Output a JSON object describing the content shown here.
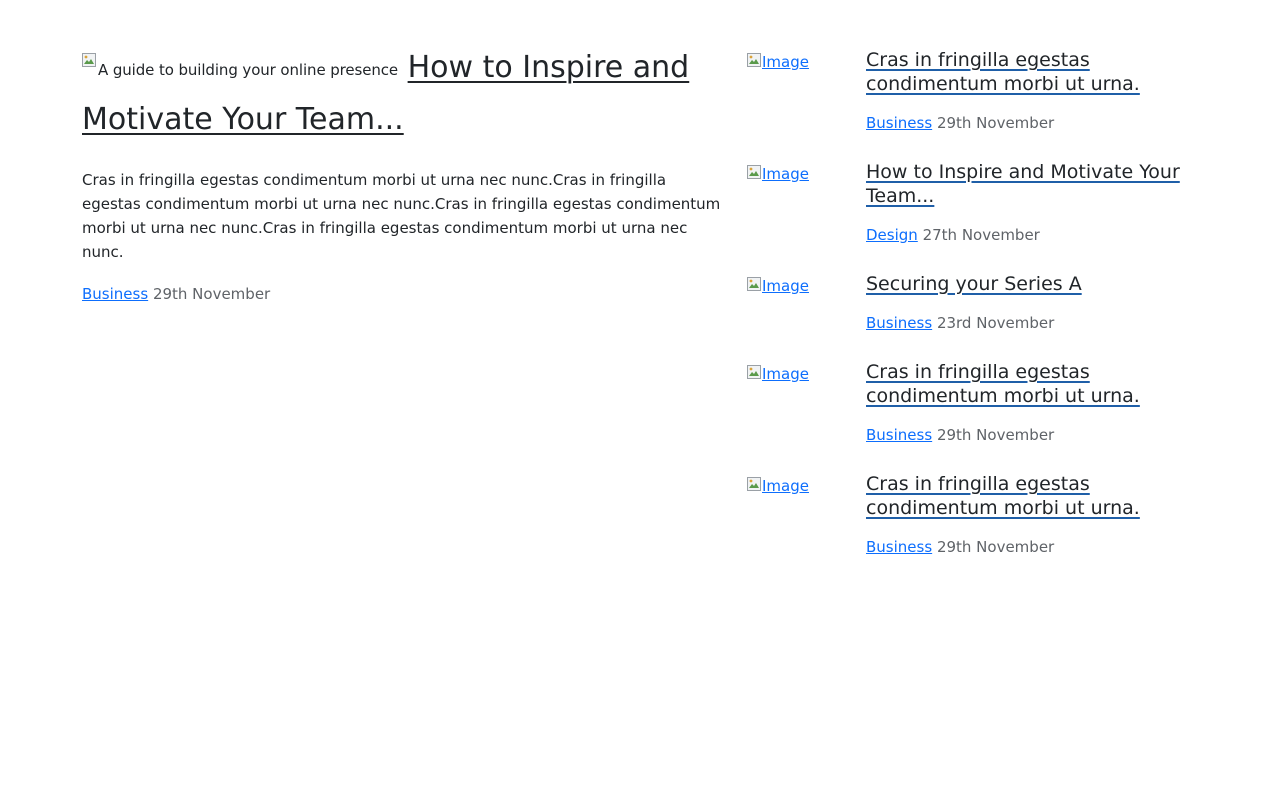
{
  "featured": {
    "image_alt": "A guide to building your online presence",
    "title": "How to Inspire and Motivate Your Team...",
    "excerpt": "Cras in fringilla egestas condimentum morbi ut urna nec nunc.Cras in fringilla egestas condimentum morbi ut urna nec nunc.Cras in fringilla egestas condimentum morbi ut urna nec nunc.Cras in fringilla egestas condimentum morbi ut urna nec nunc.",
    "category": "Business",
    "date": "29th November"
  },
  "side_posts": [
    {
      "image_alt": "Image",
      "title": "Cras in fringilla egestas condimentum morbi ut urna.",
      "category": "Business",
      "date": "29th November"
    },
    {
      "image_alt": "Image",
      "title": "How to Inspire and Motivate Your Team...",
      "category": "Design",
      "date": "27th November"
    },
    {
      "image_alt": "Image",
      "title": "Securing your Series A",
      "category": "Business",
      "date": "23rd November"
    },
    {
      "image_alt": "Image",
      "title": "Cras in fringilla egestas condimentum morbi ut urna.",
      "category": "Business",
      "date": "29th November"
    },
    {
      "image_alt": "Image",
      "title": "Cras in fringilla egestas condimentum morbi ut urna.",
      "category": "Business",
      "date": "29th November"
    }
  ],
  "icons": {
    "broken_image": "broken-image-icon"
  },
  "colors": {
    "link": "#0d6efd",
    "text": "#212529",
    "muted": "#6c757d"
  }
}
